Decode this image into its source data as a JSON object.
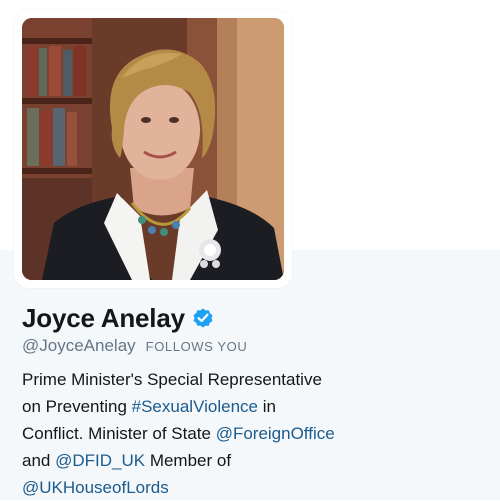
{
  "profile": {
    "name": "Joyce Anelay",
    "screen_name": "@JoyceAnelay",
    "follows_you": "FOLLOWS YOU",
    "verified_icon": "verified-badge-icon",
    "bio": {
      "line1": "Prime Minister's Special Representative",
      "line2_pre": "on Preventing ",
      "hashtag": "#SexualViolence",
      "line2_post": " in",
      "line3_pre": "Conflict. Minister of State ",
      "mention_fco": "@ForeignOffice",
      "line4_pre": "and ",
      "mention_dfid": "@DFID_UK",
      "line4_post": " Member of",
      "mention_lords": "@UKHouseofLords"
    }
  },
  "colors": {
    "link": "#1b5b8e",
    "verified": "#1da1f2",
    "secondary_text": "#657786",
    "primary_text": "#14171a",
    "background_lower": "#f5f8fa"
  }
}
